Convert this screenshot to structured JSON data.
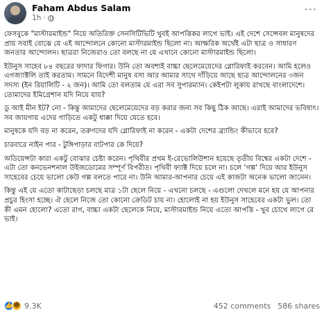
{
  "post": {
    "author": "Faham Abdus Salam",
    "time": "1h",
    "separator": "·",
    "more": "···"
  },
  "paragraphs": [
    "ফেসবুকে \"মাস্টারমাইন্ড\" নিয়ে অতিরিক্ত সেনসিটিভিটি খুবই আপত্তিকর লাগে ভাই। এই দেশে সেন্সেবল মানুষদের প্রায় সবাই বোঝে যে এই আন্দোলনে কোনো মাস্টারমাইন্ড ছিলো না। আক্ষরিক অর্থেই এটা ছাত্র ও সাধারণ জনতার আন্দোলন। ছাত্ররা নিজেরাও তো বলছে না যে এখানে কোনো মাস্টারমাইন্ড ছিলো।",
    "ইউনুস সাহেব ৮৪ বছরের ফাদার ফিগার। উনি তো অবশ্যই বাচ্চা ছেলেমেয়েদের গ্লোরিফাই করবেন। আমি হলেও এগজ্যাক্টলি তাই করতাম। সামনে বিদেশী মানুষ বসা আর আমার সাথে দাঁড়িয়ে আছে ছাত্র আন্দোলনের ৩জন সদস্য (ইন রিয়ালিটি - ২ জন)। আমি তো বলতাম যে এরা সব সুপারম্যান। কেইপটা লুকায় রাখছে বাংলাদেশে। তোমাদের ইমিগ্রেশান যদি নিয়ে যায়?",
    "ডু আই মীন ইট? নো - কিন্তু আমাদের ছেলেমেয়েদের বড় করার জন্য সব কিছু ঠিক আছে। এরাই আমাদের ভবিষ্যৎ। সব জায়গায় এদের গাড়িতে একটু ধাক্কা দিয়ে যেতে হবে।",
    "মানুষকে যদি বড় না করেন, তরুণদের যদি গ্লোরিফাই না করেন - একটা দেশের ব্র্যান্ডিং কীভাবে হবে?",
    "চারবারে নাইন পার - টুঙ্গিপাড়ার বাটপার কে দিয়ে?",
    "অডিয়েন্সটা কারা একটু বোঝার চেষ্টা করেন। পৃথিবীর প্রথম ই-রেভোলিউশান হয়েছে তৃতীয় বিশ্বের একটা দেশে - এটা তো কনভেনশনাল উইজডোমের সম্পূর্ণ বিপরীত। পৃথিবী ফ্যাক্ট দিয়ে চলে না। চলে 'গল্প' দিয়ে আর ইউনুস সাহেবের চেয়ে ভালো কেউ গল্প বলতে পারে না। উনি আমার-আপনার চেয়ে এই কাজটা অনেক ভালো জানেন।",
    "কিন্তু এই যে এতো কাটাছেড়া চলছে মাত্র ১টা ছেলে নিয়ে - এখনো চলছে - এগুলো দেখলে মনে হয় যে আপনার প্রচুর হিংসা হচ্ছে। ঐ ছেলে নিজে তো কোনো ক্রেডিট চায় না। হোলোই না হয় ইউনুস সাহেবের একটা ভুল। তো কী এমন হোলো? এতো রাগ, বাচ্চা একটা ছেলেকে নিয়ে, মাস্টারমাইন্ড নিয়ে এতো আপত্তি - খুব চোখে লাগে রে ভাই।"
  ],
  "stats": {
    "reaction_count": "9.3K",
    "comments": "452 comments",
    "shares": "586 shares"
  },
  "icons": {
    "like": "like-icon",
    "haha": "haha-icon",
    "globe": "globe-icon",
    "like_color": "#1877f2",
    "haha_color": "#f7b125"
  }
}
